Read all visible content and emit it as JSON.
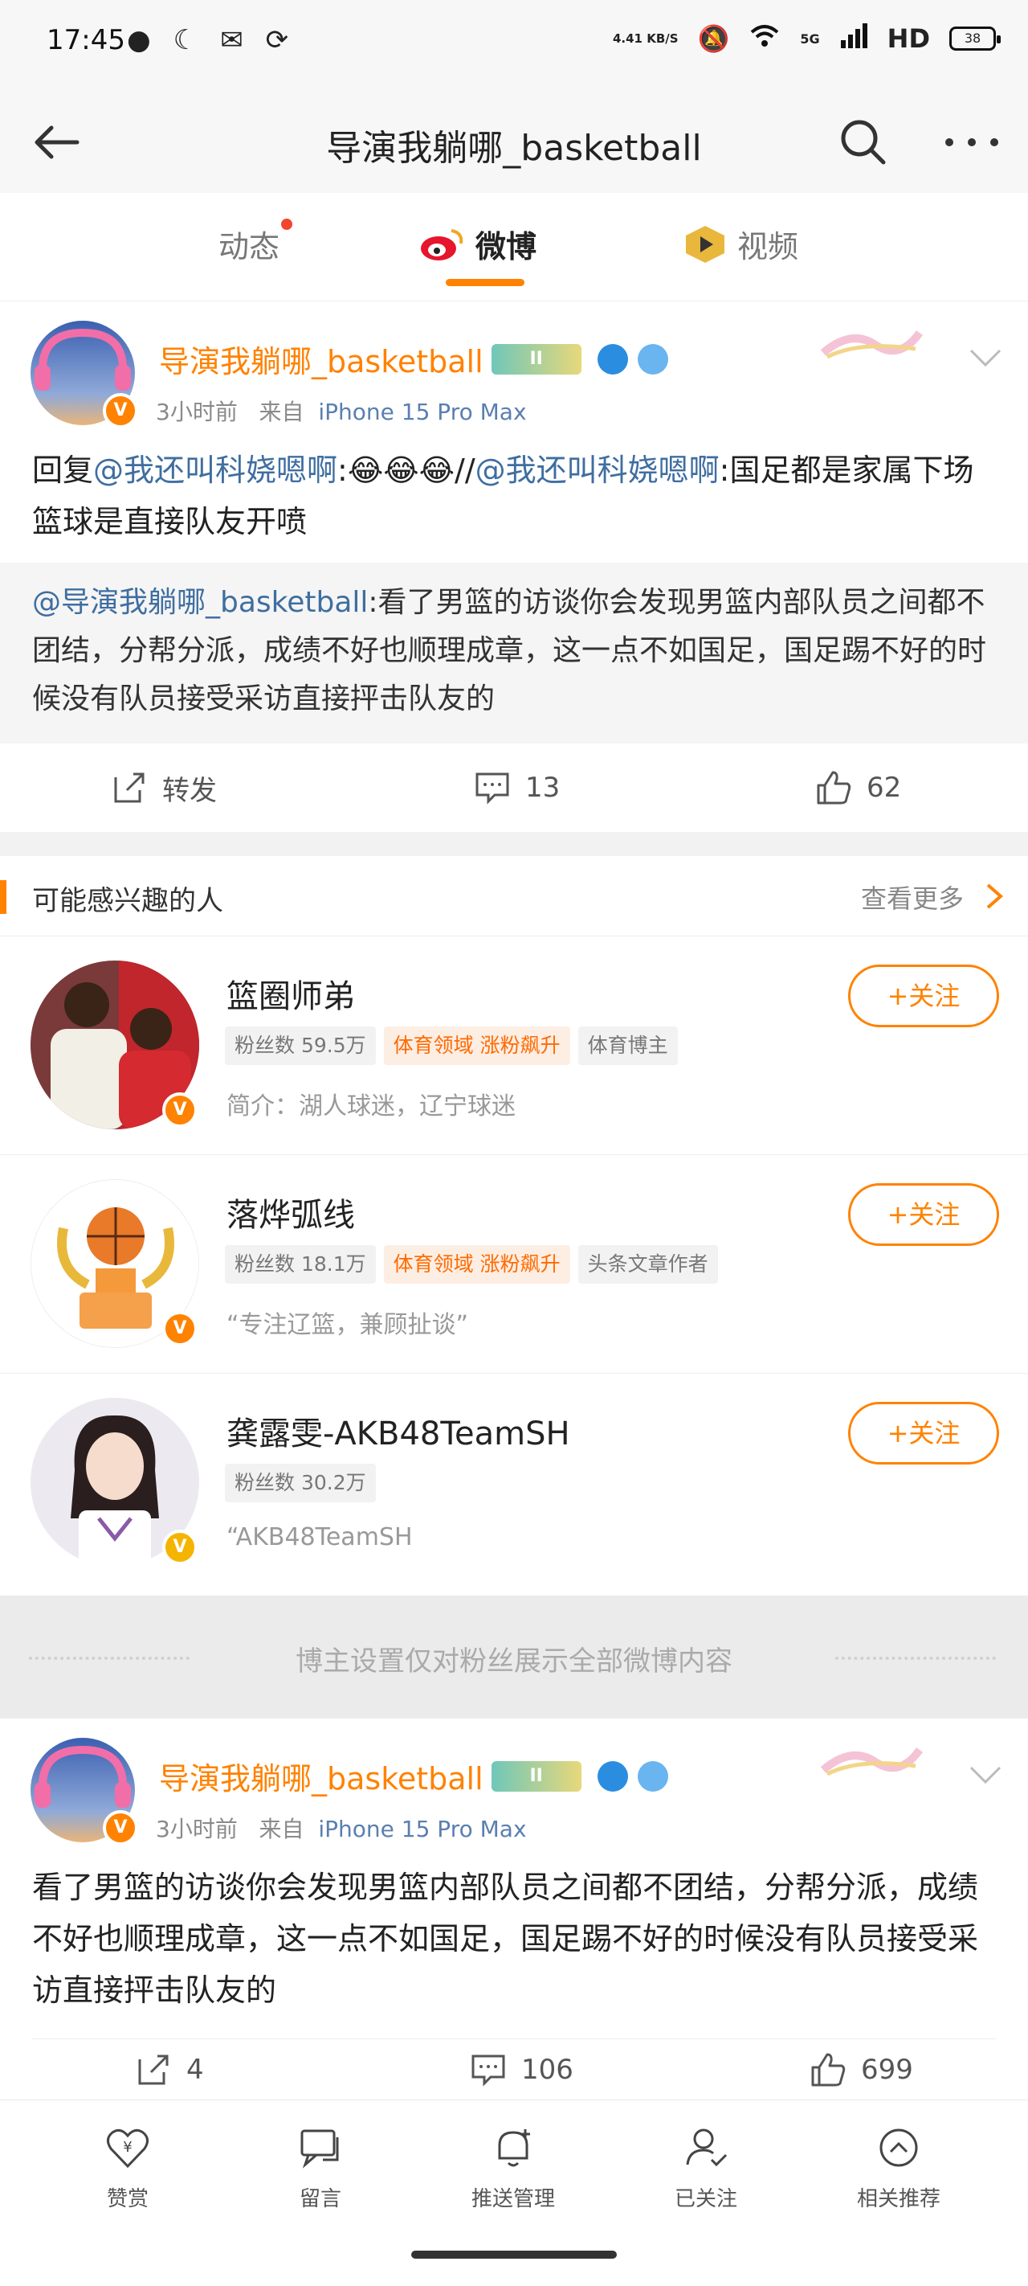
{
  "status_bar": {
    "time": "17:45",
    "net_speed": "4.41 KB/S",
    "signal": "5G",
    "hd": "HD",
    "battery": "38"
  },
  "header": {
    "title": "导演我躺哪_basketball"
  },
  "tabs": [
    {
      "label": "动态"
    },
    {
      "label": "微博"
    },
    {
      "label": "视频"
    }
  ],
  "post1": {
    "username": "导演我躺哪_basketball",
    "level_badge": "II",
    "time": "3小时前",
    "from_label": "来自",
    "source": "iPhone 15 Pro Max",
    "reply_prefix": "回复",
    "mention": "@我还叫科娆嗯啊",
    "emoji": ":😂😂😂//",
    "mention2": "@我还叫科娆嗯啊",
    "text_tail": ":国足都是家属下场 篮球是直接队友开喷",
    "quote_mention": "@导演我躺哪_basketball",
    "quote_text": ":看了男篮的访谈你会发现男篮内部队员之间都不团结，分帮分派，成绩不好也顺理成章，这一点不如国足，国足踢不好的时候没有队员接受采访直接抨击队友的",
    "repost_label": "转发",
    "comments": "13",
    "likes": "62"
  },
  "recommend": {
    "title": "可能感兴趣的人",
    "more": "查看更多",
    "follow_label": "+关注",
    "people": [
      {
        "name": "篮圈师弟",
        "tags": [
          "粉丝数 59.5万",
          "体育领域 涨粉飙升",
          "体育博主"
        ],
        "bio": "简介：湖人球迷，辽宁球迷"
      },
      {
        "name": "落烨弧线",
        "tags": [
          "粉丝数 18.1万",
          "体育领域 涨粉飙升",
          "头条文章作者"
        ],
        "bio": "“专注辽篮，兼顾扯谈”"
      },
      {
        "name": "龚露雯-AKB48TeamSH",
        "tags": [
          "粉丝数 30.2万"
        ],
        "bio": "“AKB48TeamSH"
      }
    ]
  },
  "notice": {
    "text": "博主设置仅对粉丝展示全部微博内容"
  },
  "post2": {
    "username": "导演我躺哪_basketball",
    "level_badge": "II",
    "time": "3小时前",
    "from_label": "来自",
    "source": "iPhone 15 Pro Max",
    "text": "看了男篮的访谈你会发现男篮内部队员之间都不团结，分帮分派，成绩不好也顺理成章，这一点不如国足，国足踢不好的时候没有队员接受采访直接抨击队友的",
    "reposts": "4",
    "comments": "106",
    "likes": "699"
  },
  "toolbar": {
    "items": [
      "赞赏",
      "留言",
      "推送管理",
      "已关注",
      "相关推荐"
    ]
  },
  "colors": {
    "accent": "#ff8200",
    "link": "#3f6ea0",
    "background": "#f2f2f2"
  }
}
